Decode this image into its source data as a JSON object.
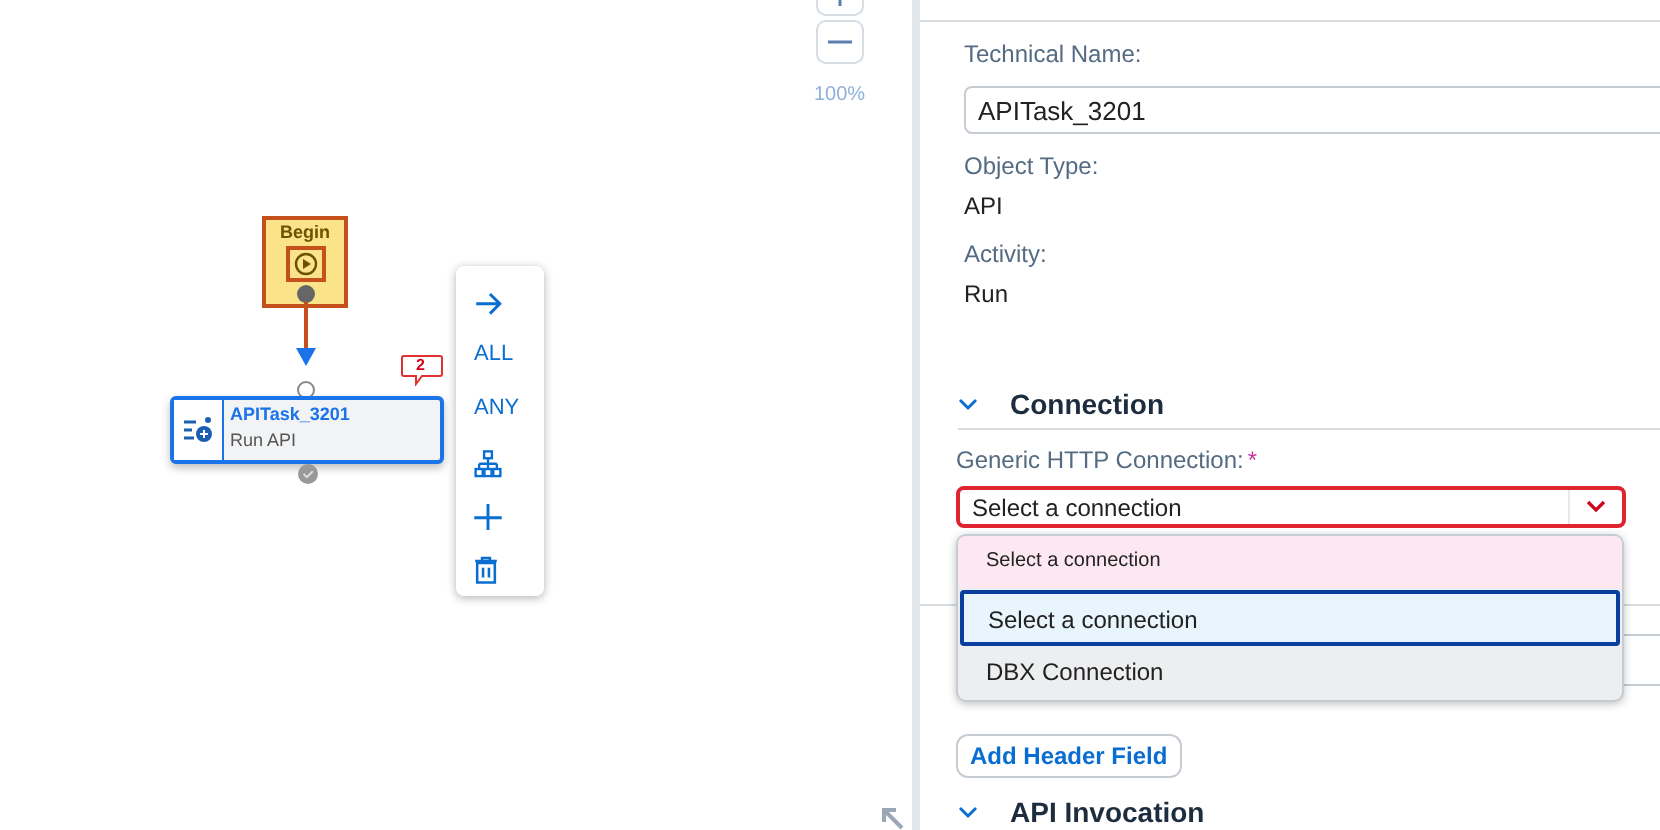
{
  "canvas": {
    "zoom_label": "100%",
    "begin_node": {
      "title": "Begin"
    },
    "task_node": {
      "title": "APITask_3201",
      "subtitle": "Run API",
      "badge": "2",
      "selected": true
    },
    "context_menu": [
      {
        "kind": "arrow"
      },
      {
        "kind": "text",
        "label": "ALL"
      },
      {
        "kind": "text",
        "label": "ANY"
      },
      {
        "kind": "hierarchy"
      },
      {
        "kind": "plus"
      },
      {
        "kind": "delete"
      }
    ]
  },
  "properties": {
    "fields": [
      {
        "label": "Technical Name:",
        "kind": "input",
        "value": "APITask_3201"
      },
      {
        "label": "Object Type:",
        "kind": "text",
        "value": "API"
      },
      {
        "label": "Activity:",
        "kind": "text",
        "value": "Run"
      }
    ],
    "connection": {
      "title": "Connection",
      "expanded": true,
      "label": "Generic HTTP Connection:",
      "required_mark": "*",
      "value": "Select a connection",
      "error": true,
      "dropdown": {
        "header": "Select a connection",
        "options": [
          {
            "label": "Select a connection",
            "selected": true
          },
          {
            "label": "DBX Connection",
            "selected": false
          }
        ]
      }
    },
    "add_button": "Add Header Field",
    "next_section": {
      "title": "API Invocation",
      "expanded": true
    }
  }
}
